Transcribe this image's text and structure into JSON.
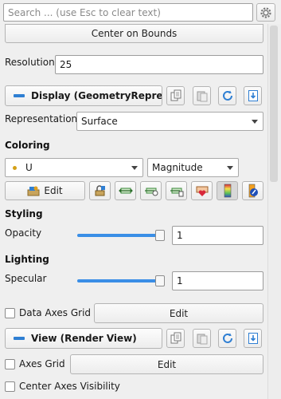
{
  "search": {
    "placeholder": "Search ... (use Esc to clear text)"
  },
  "center_on_bounds": "Center on Bounds",
  "resolution": {
    "label": "Resolution",
    "value": "25"
  },
  "display_section": {
    "title": "Display (GeometryRepresentation)"
  },
  "representation": {
    "label": "Representation",
    "value": "Surface"
  },
  "coloring": {
    "label": "Coloring",
    "array": "U",
    "component": "Magnitude",
    "edit": "Edit",
    "array_dot_color": "#d4a017"
  },
  "styling": {
    "label": "Styling",
    "opacity_label": "Opacity",
    "opacity_value": "1",
    "opacity_level": 1
  },
  "lighting": {
    "label": "Lighting",
    "specular_label": "Specular",
    "specular_value": "1",
    "specular_level": 1
  },
  "data_axes_grid": {
    "label": "Data Axes Grid",
    "edit": "Edit"
  },
  "view_section": {
    "title": "View (Render View)"
  },
  "axes_grid": {
    "label": "Axes Grid",
    "edit": "Edit"
  },
  "center_axes": {
    "label": "Center Axes Visibility"
  },
  "colors": {
    "accent": "#2f7fd3",
    "slider": "#3a8ee6"
  }
}
